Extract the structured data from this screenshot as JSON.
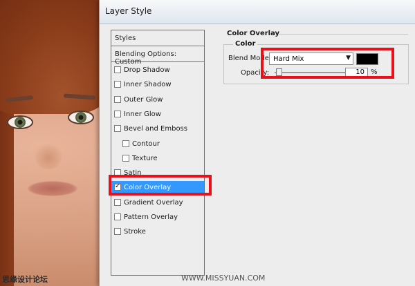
{
  "dialog": {
    "title": "Layer Style"
  },
  "styles_list": {
    "header": "Styles",
    "blending": "Blending Options: Custom",
    "items": [
      {
        "label": "Drop Shadow",
        "checked": false,
        "indent": false,
        "selected": false
      },
      {
        "label": "Inner Shadow",
        "checked": false,
        "indent": false,
        "selected": false
      },
      {
        "label": "Outer Glow",
        "checked": false,
        "indent": false,
        "selected": false
      },
      {
        "label": "Inner Glow",
        "checked": false,
        "indent": false,
        "selected": false
      },
      {
        "label": "Bevel and Emboss",
        "checked": false,
        "indent": false,
        "selected": false
      },
      {
        "label": "Contour",
        "checked": false,
        "indent": true,
        "selected": false
      },
      {
        "label": "Texture",
        "checked": false,
        "indent": true,
        "selected": false
      },
      {
        "label": "Satin",
        "checked": false,
        "indent": false,
        "selected": false
      },
      {
        "label": "Color Overlay",
        "checked": true,
        "indent": false,
        "selected": true
      },
      {
        "label": "Gradient Overlay",
        "checked": false,
        "indent": false,
        "selected": false
      },
      {
        "label": "Pattern Overlay",
        "checked": false,
        "indent": false,
        "selected": false
      },
      {
        "label": "Stroke",
        "checked": false,
        "indent": false,
        "selected": false
      }
    ]
  },
  "color_overlay": {
    "section_title": "Color Overlay",
    "group_title": "Color",
    "blend_mode_label": "Blend Mode:",
    "blend_mode_value": "Hard Mix",
    "overlay_color": "#000000",
    "opacity_label": "Opacity:",
    "opacity_value": "10",
    "opacity_unit": "%"
  },
  "highlight_color": "#e8101a",
  "watermark": {
    "left": "思缘设计论坛",
    "right": "WWW.MISSYUAN.COM"
  }
}
